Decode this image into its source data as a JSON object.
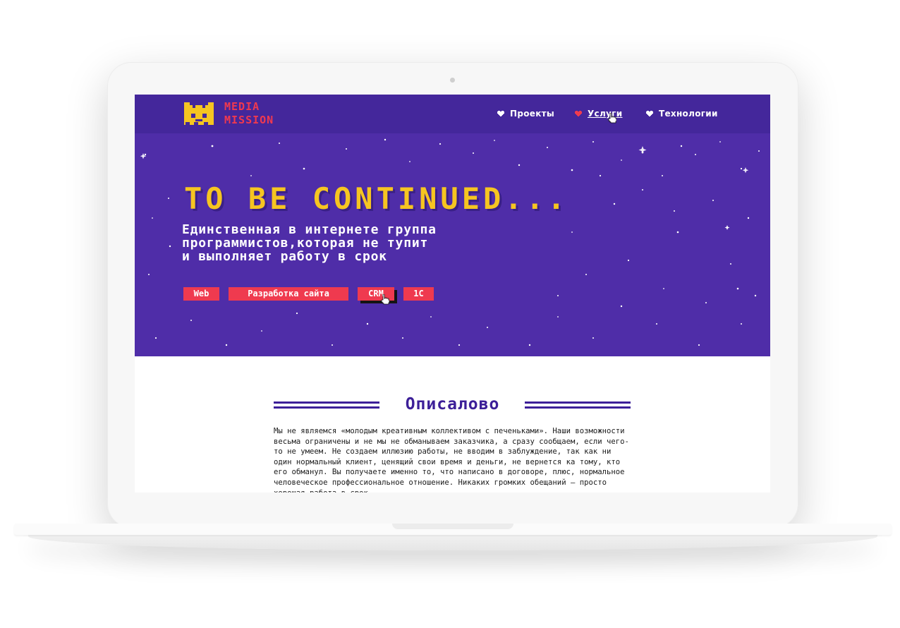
{
  "brand": {
    "name_line1": "MEDIA",
    "name_line2": "MISSION",
    "logo_color": "#f6c521",
    "text_color": "#f0394f"
  },
  "nav": {
    "items": [
      {
        "label": "Проекты",
        "active": false
      },
      {
        "label": "Услуги",
        "active": true
      },
      {
        "label": "Технологии",
        "active": false
      }
    ]
  },
  "hero": {
    "title": "TO BE CONTINUED...",
    "subtitle_lines": [
      "Единственная в интернете группа",
      "программистов,которая не тупит",
      "и выполняет работу в срок"
    ],
    "tags": [
      {
        "label": "Web"
      },
      {
        "label": "Разработка сайта"
      },
      {
        "label": "CRM"
      },
      {
        "label": "1C"
      }
    ],
    "background": "#4f2da8",
    "title_color": "#f6c521"
  },
  "about": {
    "title": "Описалово",
    "text": "Мы не являемся «молодым креативным коллективом с печеньками». Наши возможности весьма ограничены и не мы не обманываем заказчика, а сразу сообщаем, если чего-то не умеем. Не создаем иллюзию работы, не вводим в заблуждение, так как ни один нормальный клиент, ценящий свои время и деньги, не вернется ка тому, кто его обманул. Вы получаете именно то, что написано в договоре, плюс, нормальное человеческое профессиональное отношение. Никаких громких обещаний – просто хорошая работа в срок."
  },
  "colors": {
    "nav_bg": "#44279b",
    "accent_red": "#ef3a4f",
    "section_title": "#3c1f98"
  }
}
